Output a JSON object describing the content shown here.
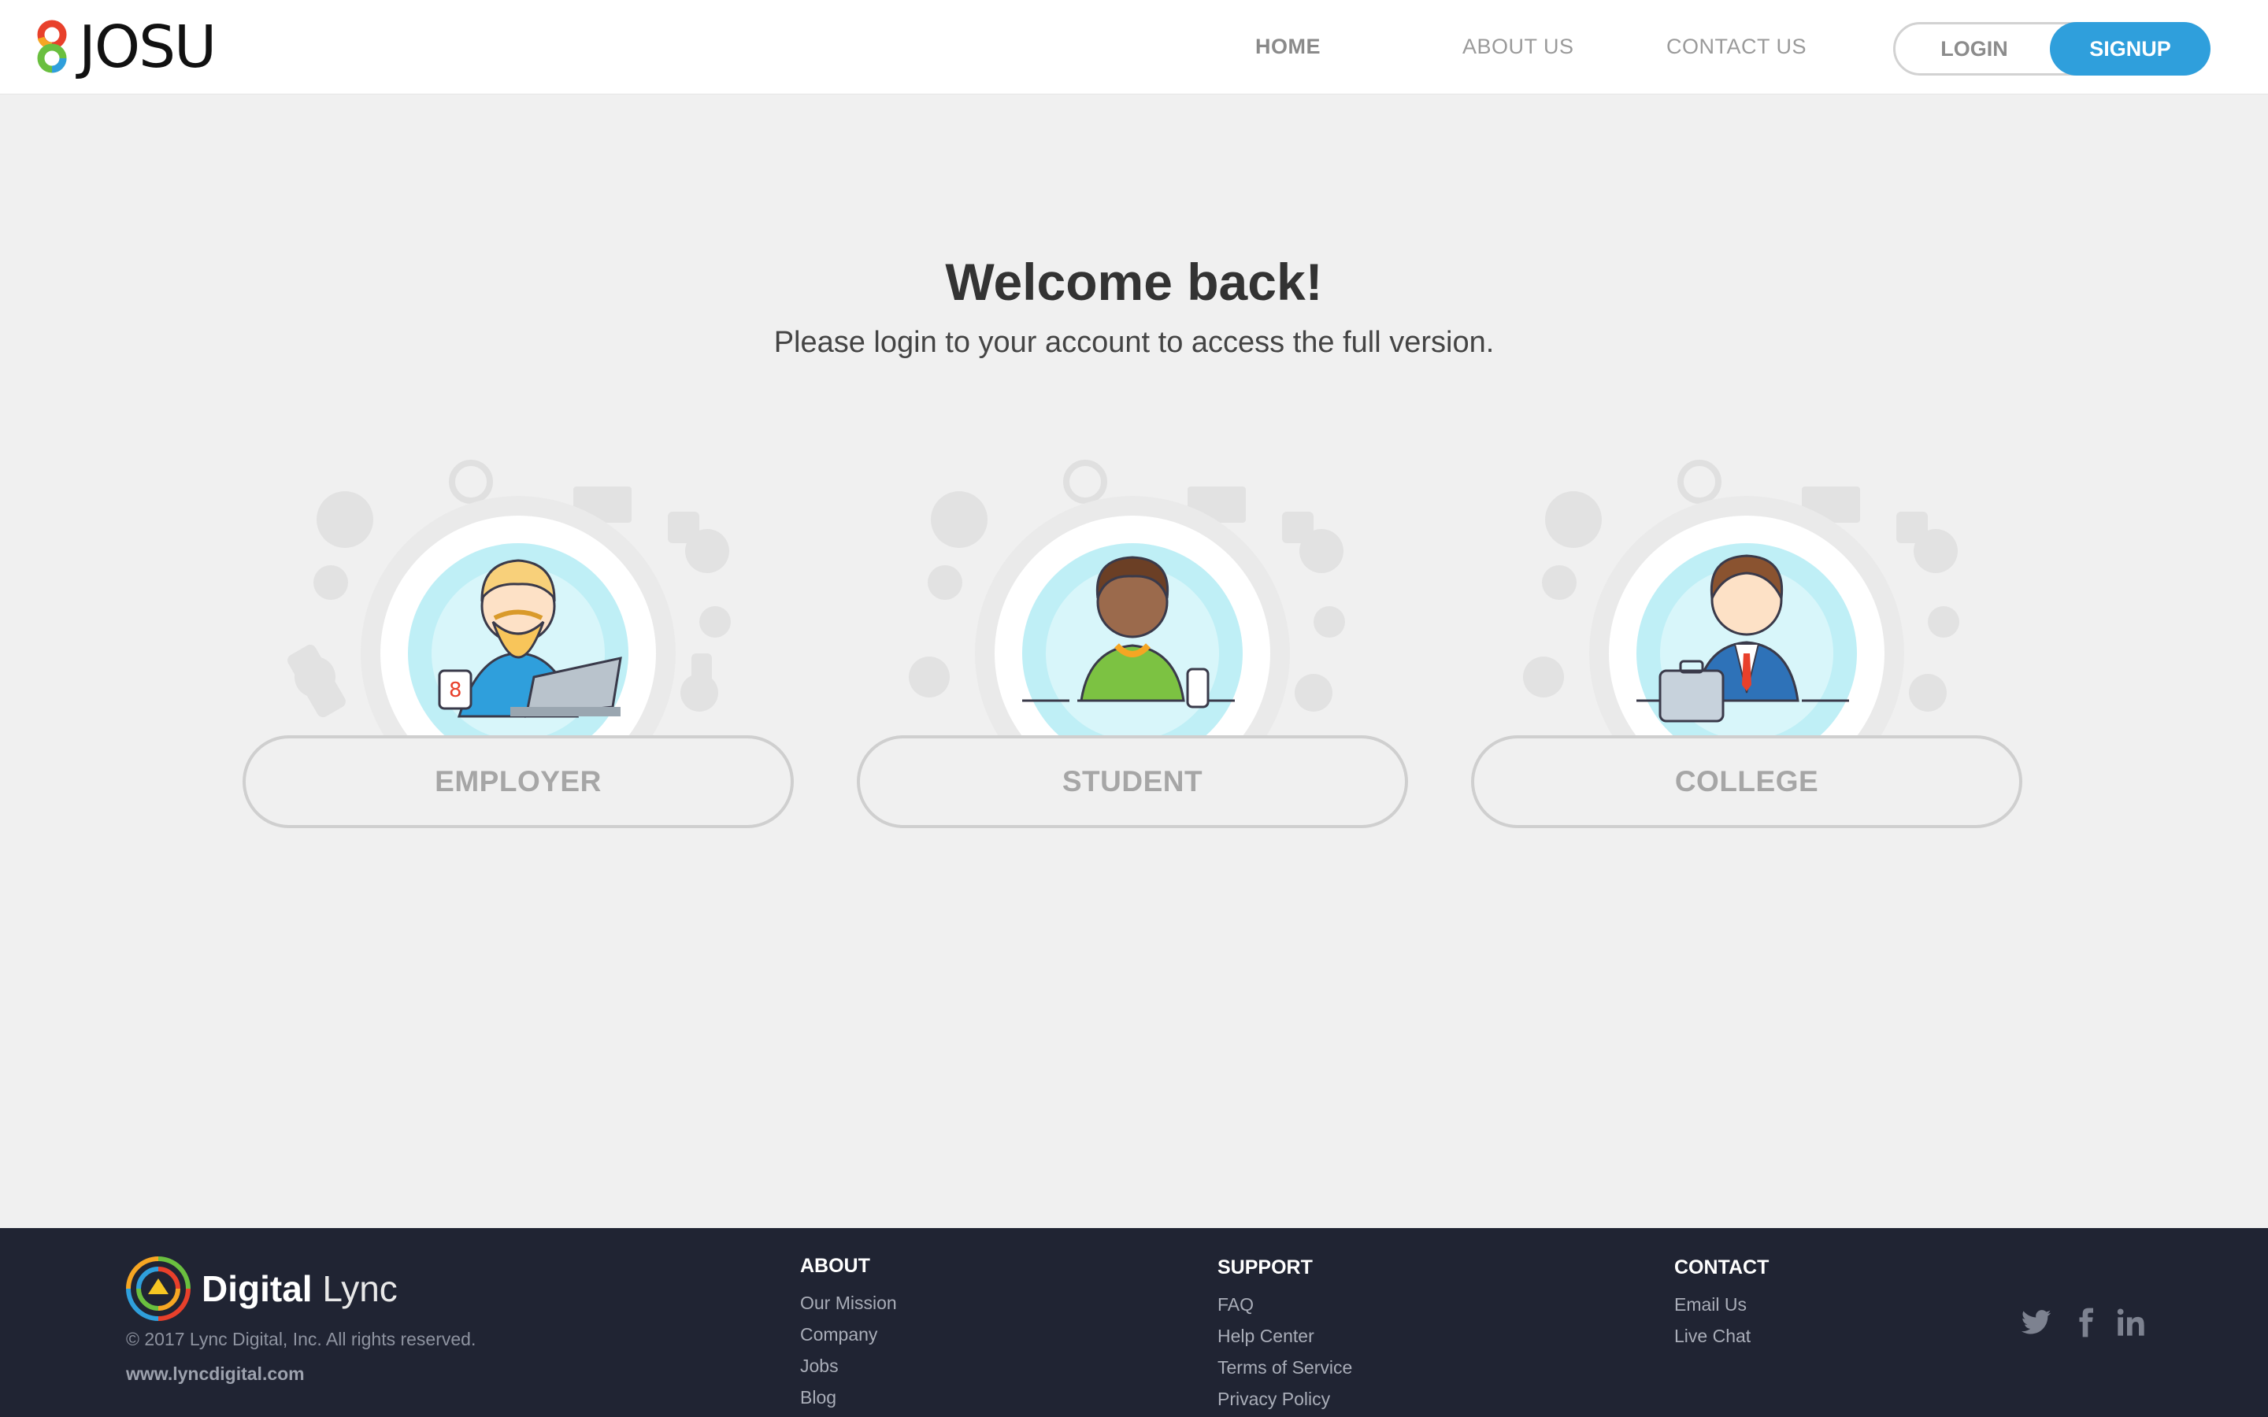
{
  "brand": {
    "name": "JOSU"
  },
  "nav": {
    "home": "HOME",
    "about": "ABOUT US",
    "contact": "CONTACT US",
    "login": "LOGIN",
    "signup": "SIGNUP"
  },
  "hero": {
    "title": "Welcome back!",
    "subtitle": "Please login to your account to access the full version."
  },
  "roles": [
    {
      "label": "EMPLOYER"
    },
    {
      "label": "STUDENT"
    },
    {
      "label": "COLLEGE"
    }
  ],
  "footer": {
    "company": {
      "name_bold": "Digital",
      "name_light": "Lync"
    },
    "copyright": "© 2017 Lync Digital, Inc. All rights reserved.",
    "website": "www.lyncdigital.com",
    "about": {
      "heading": "ABOUT",
      "links": [
        "Our Mission",
        "Company",
        "Jobs",
        "Blog"
      ]
    },
    "support": {
      "heading": "SUPPORT",
      "links": [
        "FAQ",
        "Help Center",
        "Terms of Service",
        "Privacy Policy"
      ]
    },
    "contact": {
      "heading": "CONTACT",
      "links": [
        "Email Us",
        "Live Chat"
      ]
    },
    "social": [
      "twitter-icon",
      "facebook-icon",
      "linkedin-icon"
    ]
  },
  "colors": {
    "accent": "#2f9fdc",
    "footer_bg": "#202433",
    "page_bg": "#f0f0f0"
  }
}
